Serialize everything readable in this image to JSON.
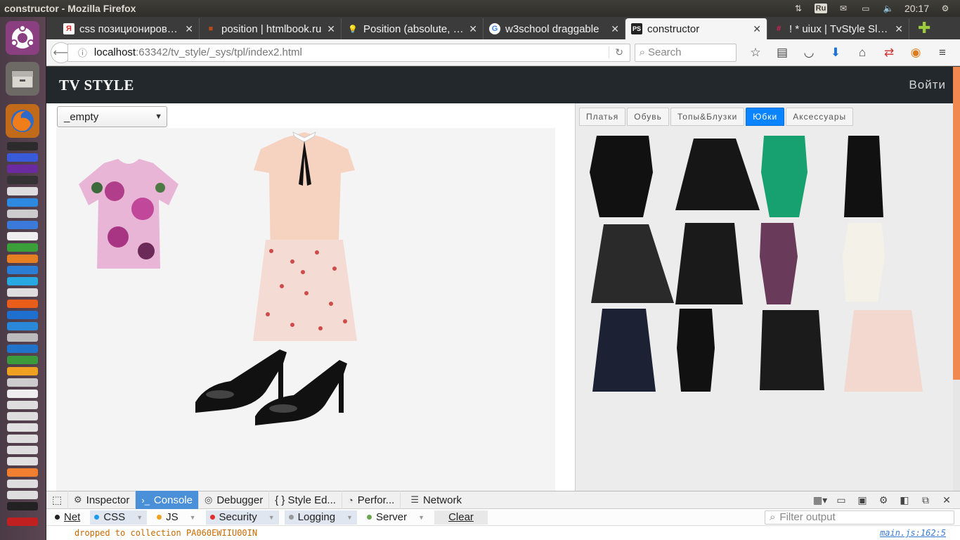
{
  "os": {
    "window_title": "constructor - Mozilla Firefox",
    "keyboard_layout": "Ru",
    "clock": "20:17"
  },
  "browser": {
    "tabs": [
      {
        "label": "css позиционирование",
        "favicon": "Я",
        "favicon_color": "#e52620",
        "active": false
      },
      {
        "label": "position | htmlbook.ru",
        "favicon": "■",
        "favicon_color": "#b54a1b",
        "active": false
      },
      {
        "label": "Position (absolute, relative)",
        "favicon": "💡",
        "favicon_color": "#f5c400",
        "active": false
      },
      {
        "label": "w3school draggable",
        "favicon": "G",
        "favicon_color": "#4285f4",
        "active": false
      },
      {
        "label": "constructor",
        "favicon": "PS",
        "favicon_color": "#222222",
        "active": true
      },
      {
        "label": "! * uiux | TvStyle Slack",
        "favicon": "#",
        "favicon_color": "#e01e5a",
        "active": false
      }
    ],
    "url_host": "localhost",
    "url_path": ":63342/tv_style/_sys/tpl/index2.html",
    "search_placeholder": "Search"
  },
  "site": {
    "logo": "TV STYLE",
    "login": "Войти",
    "outfit_select_value": "_empty",
    "categories": [
      {
        "label": "Платья",
        "active": false
      },
      {
        "label": "Обувь",
        "active": false
      },
      {
        "label": "Топы&Блузки",
        "active": false
      },
      {
        "label": "Юбки",
        "active": true
      },
      {
        "label": "Аксессуары",
        "active": false
      }
    ]
  },
  "devtools": {
    "tabs": [
      {
        "label": "Inspector",
        "glyph": "⚙",
        "active": false
      },
      {
        "label": "Console",
        "glyph": "›_",
        "active": true
      },
      {
        "label": "Debugger",
        "glyph": "◎",
        "active": false
      },
      {
        "label": "{ } Style Ed...",
        "glyph": "",
        "active": false
      },
      {
        "label": "Perfor...",
        "glyph": "◔",
        "active": false
      },
      {
        "label": "Network",
        "glyph": "☰",
        "active": false
      }
    ],
    "filters": [
      {
        "label": "Net",
        "dot": "#222222",
        "on": false
      },
      {
        "label": "CSS",
        "dot": "#1a9bf0",
        "on": true
      },
      {
        "label": "JS",
        "dot": "#f0a020",
        "on": false
      },
      {
        "label": "Security",
        "dot": "#e03030",
        "on": true
      },
      {
        "label": "Logging",
        "dot": "#999999",
        "on": true
      },
      {
        "label": "Server",
        "dot": "#6aa84f",
        "on": false
      }
    ],
    "clear_label": "Clear",
    "filter_placeholder": "Filter output",
    "log_message": "dropped to collection PA060EWIIU00IN",
    "log_source": "main.js:162:5"
  }
}
